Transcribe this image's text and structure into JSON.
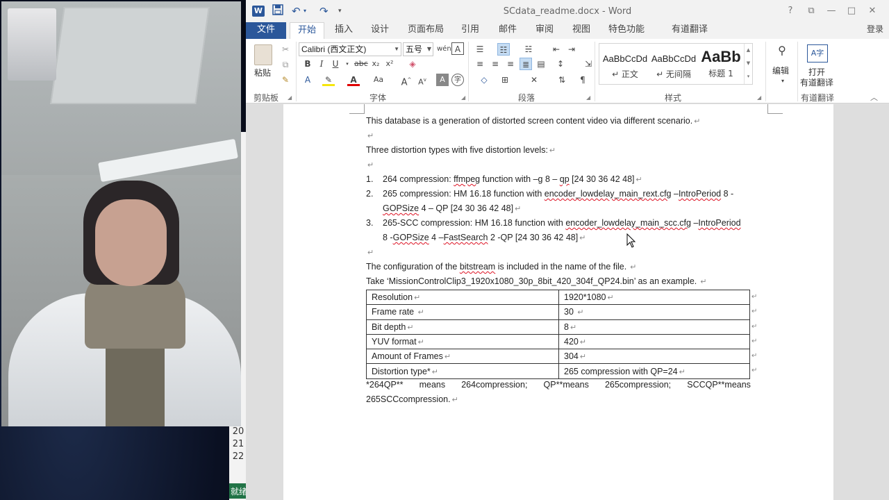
{
  "left_panel": {
    "line_numbers": [
      "20",
      "21",
      "22"
    ],
    "status": "就绪"
  },
  "titlebar": {
    "app_icon": "W",
    "title": "SCdata_readme.docx - Word",
    "controls": [
      "?",
      "⧉",
      "—",
      "□",
      "✕"
    ]
  },
  "tabs": [
    "文件",
    "开始",
    "插入",
    "设计",
    "页面布局",
    "引用",
    "邮件",
    "审阅",
    "视图",
    "特色功能",
    "有道翻译"
  ],
  "active_tab": "开始",
  "login": "登录",
  "ribbon": {
    "clipboard": {
      "paste": "粘贴",
      "label": "剪贴板"
    },
    "font": {
      "family": "Calibri (西文正文)",
      "size": "五号",
      "label": "字体"
    },
    "paragraph": {
      "label": "段落"
    },
    "styles": {
      "items": [
        {
          "sample": "AaBbCcDd",
          "name": "↵ 正文"
        },
        {
          "sample": "AaBbCcDd",
          "name": "↵ 无间隔"
        },
        {
          "sample": "AaBb",
          "name": "标题 1"
        }
      ],
      "label": "样式"
    },
    "editing": {
      "label": "编辑"
    },
    "youdao": {
      "open": "打开",
      "sub": "有道翻译",
      "label": "有道翻译"
    }
  },
  "document": {
    "p1": "This database is a generation of distorted screen content video via different scenario.",
    "p2": "Three distortion types with five distortion levels:",
    "list": [
      {
        "num": "1.",
        "pre": "264 compression: ",
        "w1": "ffmpeg",
        "mid": " function with –g 8 – ",
        "w2": "qp",
        "post": " [24 30 36 42 48]"
      },
      {
        "num": "2.",
        "pre": "265 compression: HM 16.18 function with ",
        "w1": "encoder_lowdelay_main_rext.cfg",
        "mid": " –",
        "w2": "IntroPeriod",
        "post": " 8 -",
        "cont_w": "GOPSize",
        "cont_post": " 4 – QP [24 30 36 42 48]"
      },
      {
        "num": "3.",
        "pre": "265-SCC compression: HM 16.18 function with ",
        "w1": "encoder_lowdelay_main_scc.cfg",
        "mid": " –",
        "w2": "IntroPeriod",
        "post": "",
        "cont_pre": "8 -",
        "cont_w": "GOPSize",
        "cont_mid": " 4 –",
        "cont_w2": "FastSearch",
        "cont_post": " 2 -QP [24 30 36 42 48]"
      }
    ],
    "p3_pre": "The configuration of the ",
    "p3_w": "bitstream",
    "p3_post": " is included in the name of the file.",
    "p4": "Take ‘MissionControlClip3_1920x1080_30p_8bit_420_304f_QP24.bin’ as an example.",
    "table": [
      [
        "Resolution",
        "1920*1080"
      ],
      [
        "Frame rate ",
        "30 "
      ],
      [
        "Bit depth",
        "8"
      ],
      [
        "YUV format",
        "420"
      ],
      [
        "Amount of Frames",
        "304"
      ],
      [
        "Distortion type*",
        "265 compression with QP=24"
      ]
    ],
    "note_words": [
      "*264QP**",
      "means",
      "264compression;",
      "QP**means",
      "265compression;",
      "SCCQP**means"
    ],
    "note_line2": "265SCCcompression."
  }
}
